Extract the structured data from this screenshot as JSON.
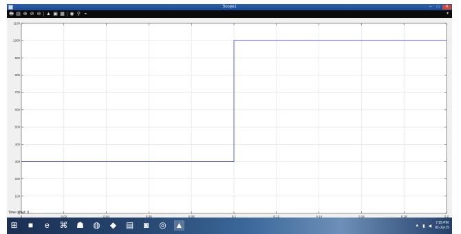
{
  "window": {
    "title": "Scope1"
  },
  "toolbar": {
    "tools": [
      {
        "name": "print-icon",
        "glyph": "🖶"
      },
      {
        "name": "parameters-icon",
        "glyph": "▤"
      },
      {
        "name": "zoom-icon",
        "glyph": "⊕"
      },
      {
        "name": "zoom-x-icon",
        "glyph": "⊘"
      },
      {
        "name": "zoom-y-icon",
        "glyph": "⊖"
      },
      {
        "name": "autoscale-icon",
        "glyph": "▲"
      },
      {
        "name": "save-axes-icon",
        "glyph": "▣"
      },
      {
        "name": "restore-axes-icon",
        "glyph": "▦"
      },
      {
        "name": "floating-scope-icon",
        "glyph": "◉"
      },
      {
        "name": "lock-axes-icon",
        "glyph": "⚲"
      },
      {
        "name": "signal-selector-icon",
        "glyph": "⌁"
      }
    ]
  },
  "chart_data": {
    "type": "line",
    "xlim": [
      0,
      0.2
    ],
    "ylim": [
      0,
      1100
    ],
    "grid": true,
    "x_ticks": [
      0,
      0.02,
      0.04,
      0.06,
      0.08,
      0.1,
      0.12,
      0.14,
      0.16,
      0.18,
      0.2
    ],
    "x_tick_labels": [
      "0",
      "0.02",
      "0.04",
      "0.06",
      "0.08",
      "0.1",
      "0.12",
      "0.14",
      "0.16",
      "0.18",
      "0.2"
    ],
    "y_ticks": [
      0,
      100,
      200,
      300,
      400,
      500,
      600,
      700,
      800,
      900,
      1000,
      1100
    ],
    "y_tick_labels": [
      "0",
      "100",
      "200",
      "300",
      "400",
      "500",
      "600",
      "700",
      "800",
      "900",
      "1000",
      "1100"
    ],
    "series": [
      {
        "color": "#5b5bd6",
        "x": [
          0,
          0.1,
          0.1,
          0.2
        ],
        "y": [
          300,
          300,
          1000,
          1000
        ]
      }
    ]
  },
  "status": {
    "time_offset": "Time offset:  0"
  },
  "taskbar": {
    "apps": [
      {
        "name": "start-button-icon",
        "glyph": "⊞"
      },
      {
        "name": "file-explorer-icon",
        "glyph": "■"
      },
      {
        "name": "internet-explorer-icon",
        "glyph": "e"
      },
      {
        "name": "network-app-icon",
        "glyph": "⌘"
      },
      {
        "name": "wizard-app-icon",
        "glyph": "☗"
      },
      {
        "name": "firefox-icon",
        "glyph": "◍"
      },
      {
        "name": "media-player-icon",
        "glyph": "◆"
      },
      {
        "name": "notepad-icon",
        "glyph": "▤"
      },
      {
        "name": "word-app-icon",
        "glyph": "◙"
      },
      {
        "name": "opera-icon",
        "glyph": "◎"
      },
      {
        "name": "matlab-icon",
        "glyph": "▲"
      }
    ],
    "clock": {
      "time": "7:25 PM",
      "date": "02-Jul-15"
    },
    "tray_icons": [
      {
        "name": "show-hidden-icons-icon",
        "glyph": "▲"
      },
      {
        "name": "network-tray-icon",
        "glyph": "▮"
      },
      {
        "name": "volume-tray-icon",
        "glyph": "◀"
      }
    ]
  },
  "colors": {
    "titlebar": "#1c4c92",
    "toolbar": "#0b0b0b",
    "plot_background": "#ffffff",
    "grid": "#d9d9d9",
    "signal": "#5b5bd6"
  }
}
